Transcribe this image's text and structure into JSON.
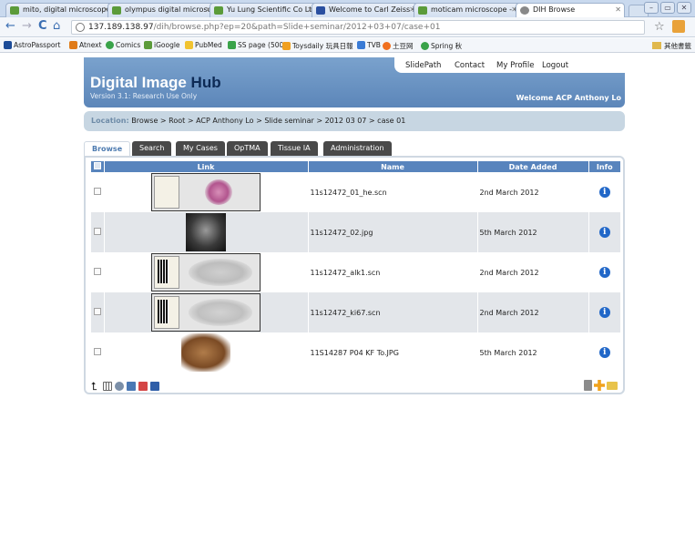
{
  "browser": {
    "tabs": [
      {
        "label": "mito, digital microscope",
        "icon_color": "#5b9b3a"
      },
      {
        "label": "olympus digital microscop",
        "icon_color": "#5b9b3a"
      },
      {
        "label": "Yu Lung Scientific Co Ltd",
        "icon_color": "#5b9b3a"
      },
      {
        "label": "Welcome to Carl Zeiss Mic",
        "icon_color": "#2a4fa0"
      },
      {
        "label": "moticam microscope - Go",
        "icon_color": "#5b9b3a"
      },
      {
        "label": "DIH Browse",
        "icon_color": "#888888"
      }
    ],
    "url_host": "137.189.138.97",
    "url_path": "/dih/browse.php?ep=20&path=Slide+seminar/2012+03+07/case+01",
    "bookmarks": [
      {
        "label": "AstroPassport",
        "color": "#1c4c98"
      },
      {
        "label": "Atnext",
        "color": "#e07b19"
      },
      {
        "label": "Comics",
        "color": "#3aa34a"
      },
      {
        "label": "iGoogle",
        "color": "#5b9b3a"
      },
      {
        "label": "PubMed",
        "color": "#f1c330"
      },
      {
        "label": "SS page (500)",
        "color": "#3aa34a"
      },
      {
        "label": "Toysdaily 玩具日報",
        "color": "#f0a020"
      },
      {
        "label": "TVB",
        "color": "#3a7bd5"
      },
      {
        "label": "土豆网",
        "color": "#f07020"
      },
      {
        "label": "Spring 秋",
        "color": "#3aa34a"
      }
    ],
    "other_bookmarks": "其他書籤"
  },
  "header": {
    "links": [
      "SlidePath",
      "Contact",
      "My Profile",
      "Logout"
    ],
    "title_main": "Digital Image",
    "title_hub": "Hub",
    "version": "Version 3.1: Research Use Only",
    "welcome": "Welcome ACP Anthony Lo"
  },
  "location": {
    "label": "Location:",
    "path": "Browse > Root > ACP Anthony Lo > Slide seminar > 2012 03 07 > case 01"
  },
  "tabs": [
    "Browse",
    "Search",
    "My Cases",
    "OpTMA",
    "Tissue IA",
    "Administration"
  ],
  "table": {
    "headers": [
      "Link",
      "Name",
      "Date Added",
      "Info"
    ],
    "rows": [
      {
        "name": "11s12472_01_he.scn",
        "date": "2nd March 2012",
        "thumb": "slide-he"
      },
      {
        "name": "11s12472_02.jpg",
        "date": "5th March 2012",
        "thumb": "xray"
      },
      {
        "name": "11s12472_alk1.scn",
        "date": "2nd March 2012",
        "thumb": "slide-ihc"
      },
      {
        "name": "11s12472_ki67.scn",
        "date": "2nd March 2012",
        "thumb": "slide-ihc"
      },
      {
        "name": "11S14287 P04 KF To.JPG",
        "date": "5th March 2012",
        "thumb": "gross"
      }
    ]
  },
  "colors": {
    "header_blue": "#6890c2",
    "table_header": "#5884bd",
    "info_icon": "#2167c8"
  }
}
